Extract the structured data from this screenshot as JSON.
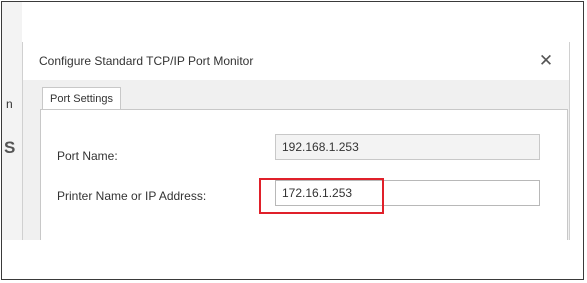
{
  "background": {
    "edge_letter_1": "n",
    "edge_letter_2": "S"
  },
  "dialog": {
    "title": "Configure Standard TCP/IP Port Monitor",
    "close_glyph": "✕",
    "tab_label": "Port Settings",
    "fields": {
      "port_name": {
        "label": "Port Name:",
        "value": "192.168.1.253"
      },
      "printer_address": {
        "label": "Printer Name or IP Address:",
        "value": "172.16.1.253"
      }
    }
  },
  "colors": {
    "highlight": "#e0202a",
    "dialog_bg": "#f0f0f0",
    "frame": "#3a3a3a"
  },
  "icons": {
    "close": "close-icon"
  }
}
